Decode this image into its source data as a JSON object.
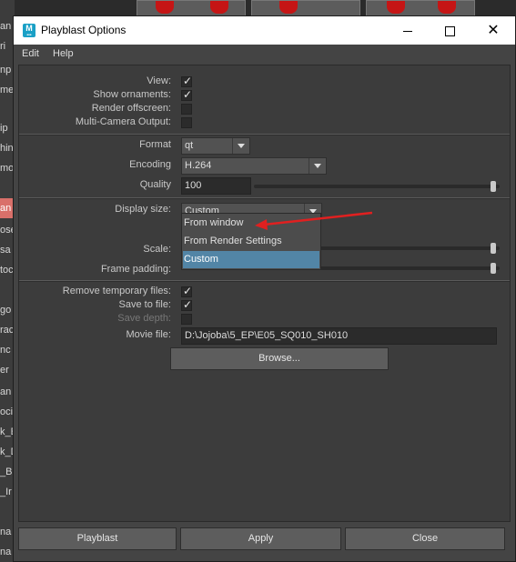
{
  "background": {
    "side_items": [
      "an",
      "ri",
      "np",
      "met",
      "ip",
      "hin",
      "mo",
      "an",
      "ose",
      "sa",
      "toc",
      "go",
      "rac",
      "nc",
      "er",
      "an",
      "oci",
      "k_E",
      "k_D",
      "_B",
      "_Ir",
      "na",
      "na"
    ],
    "selected_index": 7
  },
  "window": {
    "title": "Playblast Options",
    "app_icon_letter": "M",
    "controls": {
      "minimize": "minimize",
      "maximize": "maximize",
      "close": "✕"
    }
  },
  "menu": {
    "items": [
      "Edit",
      "Help"
    ]
  },
  "options": {
    "view_label": "View:",
    "show_ornaments_label": "Show ornaments:",
    "render_offscreen_label": "Render offscreen:",
    "multi_camera_label": "Multi-Camera Output:",
    "view_checked": true,
    "show_ornaments_checked": true,
    "render_offscreen_checked": false,
    "multi_camera_checked": false,
    "format_label": "Format",
    "format_value": "qt",
    "encoding_label": "Encoding",
    "encoding_value": "H.264",
    "quality_label": "Quality",
    "quality_value": "100",
    "display_size_label": "Display size:",
    "display_size_value": "Custom",
    "scale_label": "Scale:",
    "frame_padding_label": "Frame padding:",
    "remove_temp_label": "Remove temporary files:",
    "save_to_file_label": "Save to file:",
    "save_depth_label": "Save depth:",
    "remove_temp_checked": true,
    "save_to_file_checked": true,
    "save_depth_checked": false,
    "movie_file_label": "Movie file:",
    "movie_file_value": "D:\\Jojoba\\5_EP\\E05_SQ010_SH010",
    "browse_label": "Browse..."
  },
  "dropdown": {
    "options": [
      "From window",
      "From Render Settings",
      "Custom"
    ],
    "selected": "Custom"
  },
  "buttons": {
    "playblast": "Playblast",
    "apply": "Apply",
    "close": "Close"
  },
  "colors": {
    "accent_selection": "#5285a6",
    "annotation_arrow": "#e02020",
    "maya_icon": "#1aa0c6"
  }
}
